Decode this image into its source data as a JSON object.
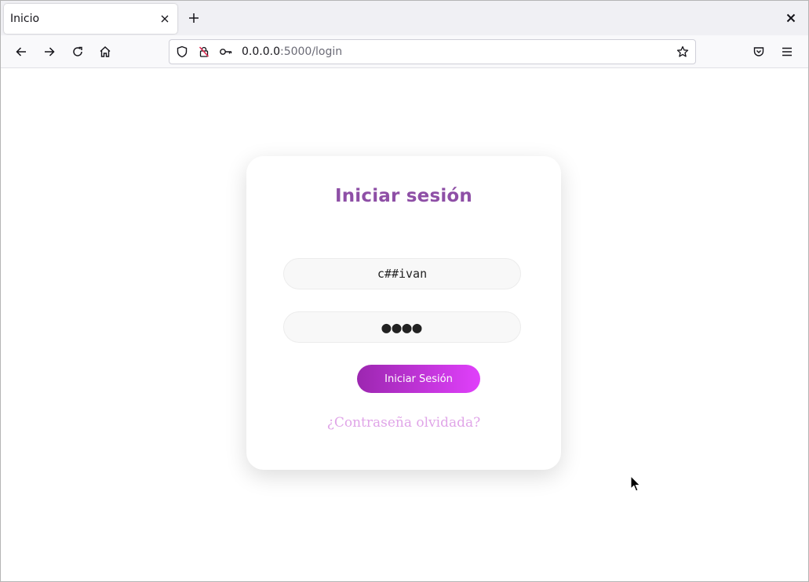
{
  "browser": {
    "tab_title": "Inicio",
    "url_host": "0.0.0.0",
    "url_path": ":5000/login"
  },
  "icons": {
    "tab_close": "close-icon",
    "new_tab": "plus-icon",
    "window_close": "close-icon",
    "back": "arrow-left-icon",
    "forward": "arrow-right-icon",
    "reload": "reload-icon",
    "home": "home-icon",
    "tracking": "shield-icon",
    "insecure": "insecure-lock-icon",
    "permissions": "key-icon",
    "bookmark": "star-icon",
    "pocket": "pocket-icon",
    "menu": "hamburger-menu-icon"
  },
  "login": {
    "title": "Iniciar sesión",
    "username_value": "c##ivan",
    "password_mask": "●●●●",
    "submit_label": "Iniciar Sesión",
    "forgot_link": "¿Contraseña olvidada?"
  },
  "colors": {
    "title": "#8e4fa6",
    "button_gradient_start": "#9c27b0",
    "button_gradient_end": "#e040fb",
    "link": "#e0a5e8"
  }
}
